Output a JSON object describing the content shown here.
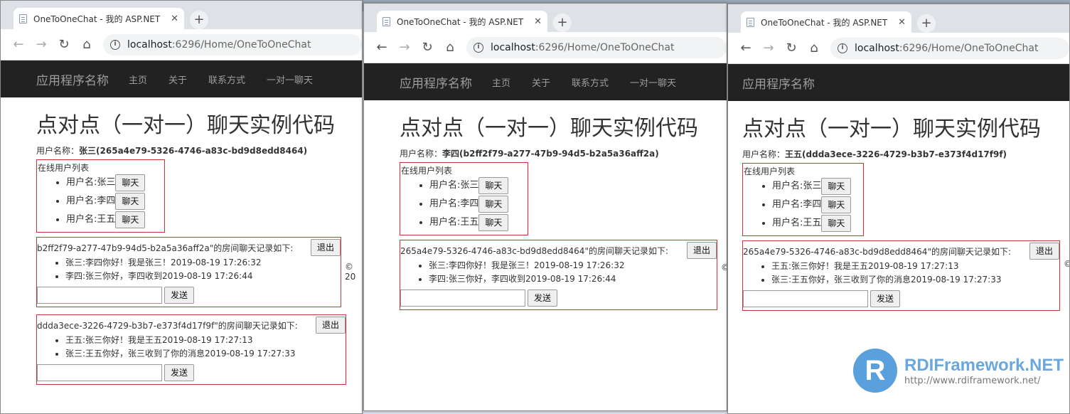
{
  "windows": [
    {
      "tab_title": "OneToOneChat - 我的 ASP.NET",
      "url_host": "localhost",
      "url_rest": ":6296/Home/OneToOneChat",
      "brand": "应用程序名称",
      "nav": [
        "主页",
        "关于",
        "联系方式",
        "一对一聊天"
      ],
      "title": "点对点（一对一）聊天实例代码",
      "user_prefix": "用户名称：",
      "user_name": "张三",
      "user_id": "(265a4e79-5326-4746-a83c-bd9d8edd8464)",
      "online_header": "在线用户列表",
      "online_users": [
        "用户名:张三",
        "用户名:李四",
        "用户名:王五"
      ],
      "chat_button": "聊天",
      "rooms": [
        {
          "header": "b2ff2f79-a277-47b9-94d5-b2a5a36aff2a\"的房间聊天记录如下:",
          "exit": "退出",
          "messages": [
            "张三:李四你好！我是张三！2019-08-19 17:26:32",
            "李四:张三你好，李四收到2019-08-19 17:26:44"
          ],
          "send": "发送"
        },
        {
          "header": "ddda3ece-3226-4729-b3b7-e373f4d17f9f\"的房间聊天记录如下:",
          "exit": "退出",
          "messages": [
            "王五:张三你好！我是王五2019-08-19 17:27:13",
            "张三:王五你好，张三收到了你的消息2019-08-19 17:27:33"
          ],
          "send": "发送"
        }
      ],
      "footer": "© 20"
    },
    {
      "tab_title": "OneToOneChat - 我的 ASP.NET",
      "url_host": "localhost",
      "url_rest": ":6296/Home/OneToOneChat",
      "brand": "应用程序名称",
      "nav": [
        "主页",
        "关于",
        "联系方式",
        "一对一聊天"
      ],
      "title": "点对点（一对一）聊天实例代码",
      "user_prefix": "用户名称：",
      "user_name": "李四",
      "user_id": "(b2ff2f79-a277-47b9-94d5-b2a5a36aff2a)",
      "online_header": "在线用户列表",
      "online_users": [
        "用户名:张三",
        "用户名:李四",
        "用户名:王五"
      ],
      "chat_button": "聊天",
      "rooms": [
        {
          "header": "265a4e79-5326-4746-a83c-bd9d8edd8464\"的房间聊天记录如下:",
          "exit": "退出",
          "messages": [
            "张三:李四你好！我是张三！2019-08-19 17:26:32",
            "李四:张三你好，李四收到2019-08-19 17:26:44"
          ],
          "send": "发送"
        }
      ],
      "footer": "©"
    },
    {
      "tab_title": "OneToOneChat - 我的 ASP.NET",
      "url_host": "localhost",
      "url_rest": ":6296/Home/OneToOneChat",
      "brand": "应用程序名称",
      "title": "点对点（一对一）聊天实例代码",
      "user_prefix": "用户名称：",
      "user_name": "王五",
      "user_id": "(ddda3ece-3226-4729-b3b7-e373f4d17f9f)",
      "online_header": "在线用户列表",
      "online_users": [
        "用户名:张三",
        "用户名:李四",
        "用户名:王五"
      ],
      "chat_button": "聊天",
      "rooms": [
        {
          "header": "265a4e79-5326-4746-a83c-bd9d8edd8464\"的房间聊天记录如下:",
          "exit": "退出",
          "messages": [
            "王五:张三你好！我是王五2019-08-19 17:27:13",
            "张三:王五你好，张三收到了你的消息2019-08-19 17:27:33"
          ],
          "send": "发送"
        }
      ],
      "footer": "©"
    }
  ],
  "watermark": {
    "logo_letter": "R",
    "title": "RDIFramework.NET",
    "url": "http://www.rdiframework.net/"
  },
  "colors": {
    "navbar_bg": "#222222",
    "box_border": "#cc3333",
    "watermark_blue": "#5aa0dd"
  },
  "icons": [
    "page-icon",
    "close-icon",
    "plus-icon",
    "back-icon",
    "forward-icon",
    "reload-icon",
    "home-icon",
    "info-icon"
  ]
}
